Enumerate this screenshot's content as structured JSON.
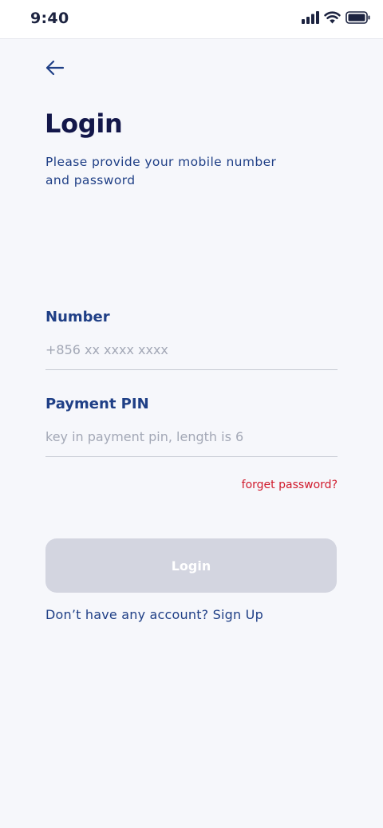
{
  "status_bar": {
    "time": "9:40"
  },
  "icons": {
    "signal": "cellular-signal-icon",
    "wifi": "wifi-icon",
    "battery": "battery-icon",
    "back": "arrow-left-icon"
  },
  "header": {
    "title": "Login",
    "subtitle": "Please provide your mobile number and password"
  },
  "form": {
    "number": {
      "label": "Number",
      "placeholder": "+856 xx xxxx xxxx",
      "value": ""
    },
    "pin": {
      "label": "Payment PIN",
      "placeholder": "key in payment pin, length is 6",
      "value": ""
    },
    "forget_label": "forget password?",
    "submit_label": "Login"
  },
  "footer": {
    "prompt": "Don’t have any account?",
    "signup_label": "Sign Up"
  },
  "colors": {
    "background": "#f6f7fb",
    "title": "#13174a",
    "primary": "#1f3f86",
    "error_link": "#d0192b",
    "button_disabled": "#d3d5e0",
    "placeholder": "#a3a8b6"
  }
}
